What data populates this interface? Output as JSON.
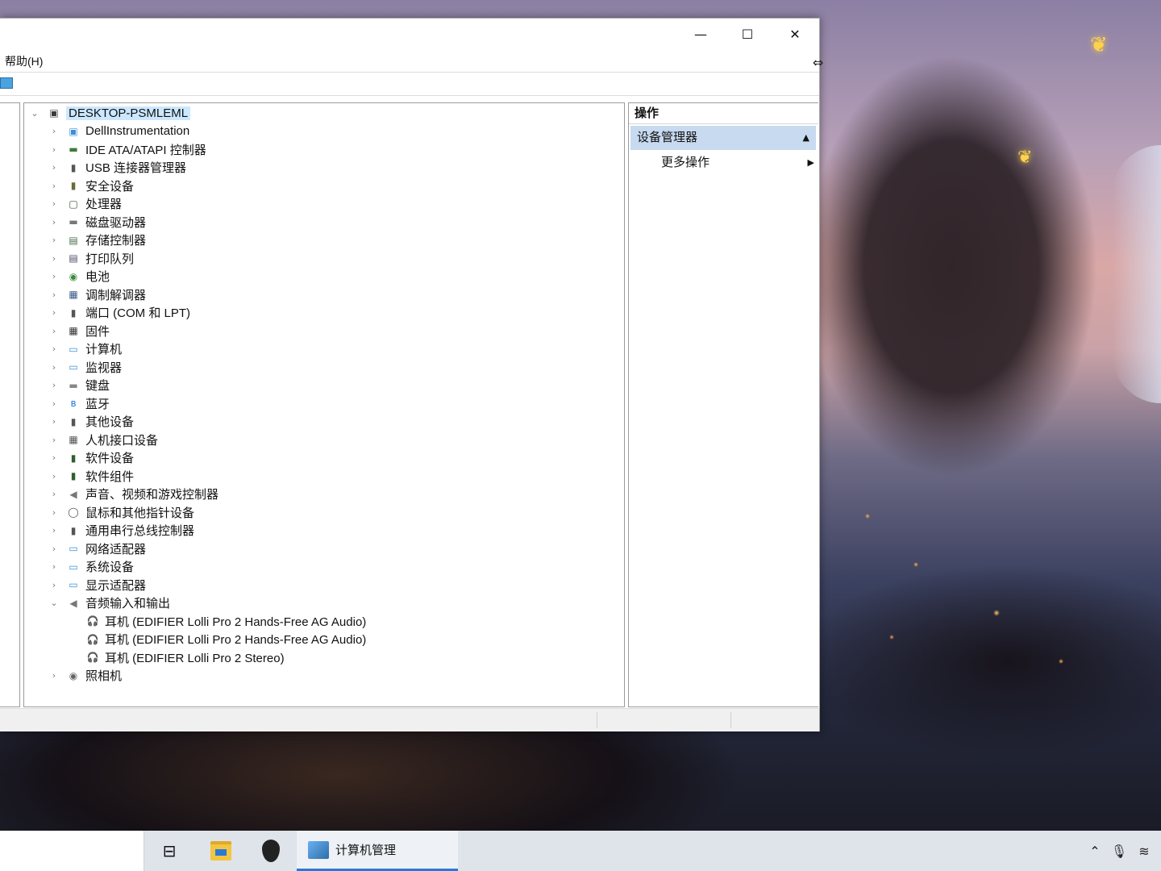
{
  "window": {
    "caption_min": "—",
    "caption_max": "☐",
    "caption_close": "✕",
    "menu_help": "帮助(H)"
  },
  "tree": {
    "root": "DESKTOP-PSMLEML",
    "categories": [
      {
        "label": "DellInstrumentation",
        "icon": "dell-instrumentation-icon",
        "glyph": "▣",
        "color": "#3a8fd6"
      },
      {
        "label": "IDE ATA/ATAPI 控制器",
        "icon": "ide-controller-icon",
        "glyph": "▬",
        "color": "#3c7a3c"
      },
      {
        "label": "USB 连接器管理器",
        "icon": "usb-connector-icon",
        "glyph": "▮",
        "color": "#555555"
      },
      {
        "label": "安全设备",
        "icon": "security-device-icon",
        "glyph": "▮",
        "color": "#6a6a3a"
      },
      {
        "label": "处理器",
        "icon": "processor-icon",
        "glyph": "▢",
        "color": "#2f5e2f"
      },
      {
        "label": "磁盘驱动器",
        "icon": "disk-drive-icon",
        "glyph": "▬",
        "color": "#777777"
      },
      {
        "label": "存储控制器",
        "icon": "storage-controller-icon",
        "glyph": "▤",
        "color": "#4a6a4a"
      },
      {
        "label": "打印队列",
        "icon": "print-queue-icon",
        "glyph": "▤",
        "color": "#4a4a6a"
      },
      {
        "label": "电池",
        "icon": "battery-icon",
        "glyph": "◉",
        "color": "#3a8a3a"
      },
      {
        "label": "调制解调器",
        "icon": "modem-icon",
        "glyph": "▦",
        "color": "#3a5a8a"
      },
      {
        "label": "端口 (COM 和 LPT)",
        "icon": "port-icon",
        "glyph": "▮",
        "color": "#555555"
      },
      {
        "label": "固件",
        "icon": "firmware-icon",
        "glyph": "▦",
        "color": "#333333"
      },
      {
        "label": "计算机",
        "icon": "computer-icon",
        "glyph": "▭",
        "color": "#3a8fd6"
      },
      {
        "label": "监视器",
        "icon": "monitor-icon",
        "glyph": "▭",
        "color": "#3a8fd6"
      },
      {
        "label": "键盘",
        "icon": "keyboard-icon",
        "glyph": "▬",
        "color": "#888888"
      },
      {
        "label": "蓝牙",
        "icon": "bluetooth-icon",
        "glyph": "ʙ",
        "color": "#1e73d2"
      },
      {
        "label": "其他设备",
        "icon": "other-devices-icon",
        "glyph": "▮",
        "color": "#555555"
      },
      {
        "label": "人机接口设备",
        "icon": "hid-icon",
        "glyph": "▦",
        "color": "#555555"
      },
      {
        "label": "软件设备",
        "icon": "software-device-icon",
        "glyph": "▮",
        "color": "#2f5e2f"
      },
      {
        "label": "软件组件",
        "icon": "software-component-icon",
        "glyph": "▮",
        "color": "#2f5e2f"
      },
      {
        "label": "声音、视频和游戏控制器",
        "icon": "sound-controller-icon",
        "glyph": "◀",
        "color": "#777777"
      },
      {
        "label": "鼠标和其他指针设备",
        "icon": "mouse-icon",
        "glyph": "◯",
        "color": "#555555"
      },
      {
        "label": "通用串行总线控制器",
        "icon": "usb-controller-icon",
        "glyph": "▮",
        "color": "#555555"
      },
      {
        "label": "网络适配器",
        "icon": "network-adapter-icon",
        "glyph": "▭",
        "color": "#3a8fd6"
      },
      {
        "label": "系统设备",
        "icon": "system-device-icon",
        "glyph": "▭",
        "color": "#3a8fd6"
      },
      {
        "label": "显示适配器",
        "icon": "display-adapter-icon",
        "glyph": "▭",
        "color": "#3a8fd6"
      }
    ],
    "audio_category": {
      "label": "音频输入和输出",
      "icon": "audio-io-icon",
      "glyph": "◀",
      "color": "#777777"
    },
    "audio_children": [
      {
        "label": "耳机 (EDIFIER Lolli Pro 2 Hands-Free AG Audio)",
        "icon": "headphones-icon"
      },
      {
        "label": "耳机 (EDIFIER Lolli Pro 2 Hands-Free AG Audio)",
        "icon": "headphones-icon"
      },
      {
        "label": "耳机 (EDIFIER Lolli Pro 2 Stereo)",
        "icon": "headphones-icon"
      }
    ],
    "camera_category": {
      "label": "照相机",
      "icon": "camera-icon",
      "glyph": "◉",
      "color": "#666666"
    }
  },
  "actions": {
    "header": "操作",
    "section": "设备管理器",
    "more": "更多操作"
  },
  "taskbar": {
    "active_app": "计算机管理"
  }
}
